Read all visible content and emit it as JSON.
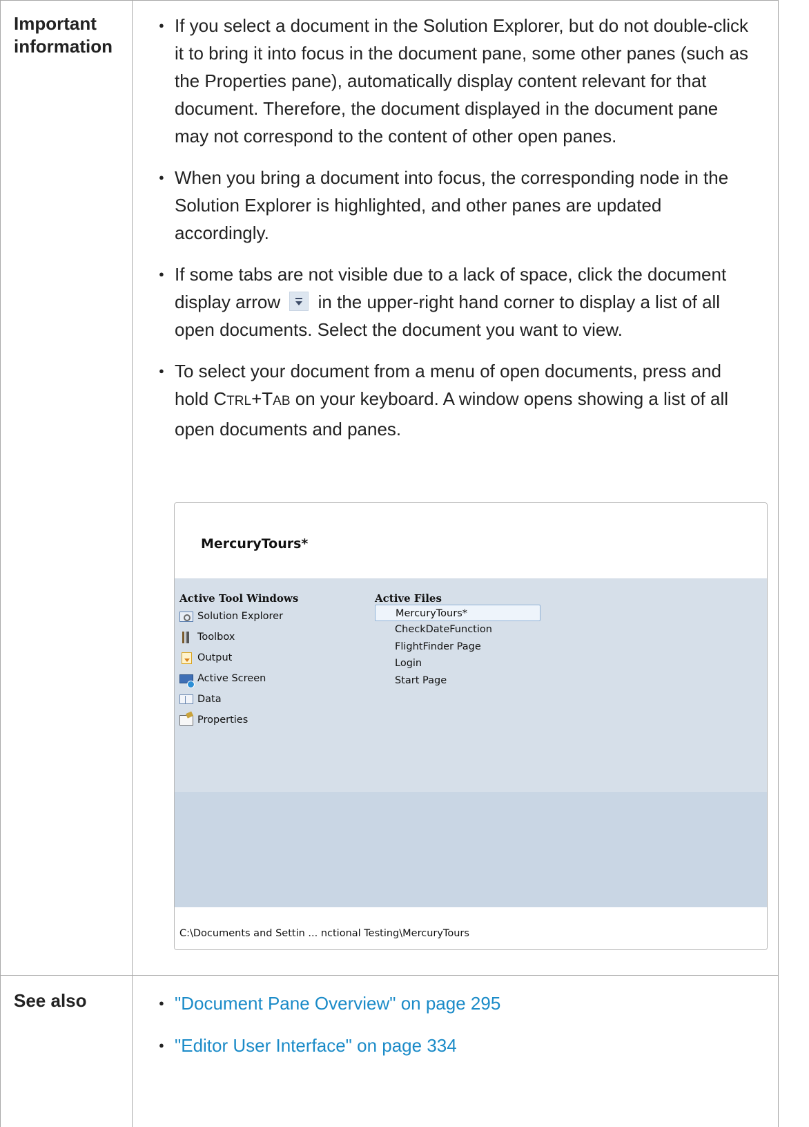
{
  "table": {
    "rows": [
      {
        "label": "Important information",
        "bullets": [
          "If you select a document in the Solution Explorer, but do not double-click it to bring it into focus in the document pane, some other panes (such as the Properties pane), automatically display content relevant for that document. Therefore, the document displayed in the document pane may not correspond to the content of other open panes.",
          "When you bring a document into focus, the corresponding node in the Solution Explorer is highlighted, and other panes are updated accordingly."
        ],
        "bullet3": {
          "before": "If some tabs are not visible due to a lack of space, click the document display arrow",
          "after": "in the upper-right hand corner to display a list of all open documents. Select the document you want to view."
        },
        "bullet4": {
          "before": "To select your document from a menu of open documents, press and hold ",
          "key1_first": "C",
          "key1_rest": "TRL",
          "plus": "+",
          "key2_first": "T",
          "key2_rest": "AB",
          "after": " on your keyboard. A window opens showing a list of all open documents and panes."
        }
      },
      {
        "label": "See also",
        "links": [
          "\"Document Pane Overview\" on page 295",
          "\"Editor User Interface\" on page 334"
        ]
      }
    ]
  },
  "screenshot": {
    "title": "MercuryTours*",
    "tool_windows_header": "Active Tool Windows",
    "files_header": "Active Files",
    "tool_windows": [
      {
        "label": "Solution Explorer",
        "icon": "solution-explorer-icon"
      },
      {
        "label": "Toolbox",
        "icon": "toolbox-icon"
      },
      {
        "label": "Output",
        "icon": "output-icon"
      },
      {
        "label": "Active Screen",
        "icon": "active-screen-icon"
      },
      {
        "label": "Data",
        "icon": "data-icon"
      },
      {
        "label": "Properties",
        "icon": "properties-icon"
      }
    ],
    "files": [
      "MercuryTours*",
      "CheckDateFunction",
      "FlightFinder Page",
      "Login",
      "Start Page"
    ],
    "selected_file": "MercuryTours*",
    "path": "C:\\Documents and Settin ... nctional Testing\\MercuryTours"
  },
  "colors": {
    "link": "#1b8bc8",
    "border": "#a8a8a8",
    "panel_body": "#d6dfe9"
  }
}
